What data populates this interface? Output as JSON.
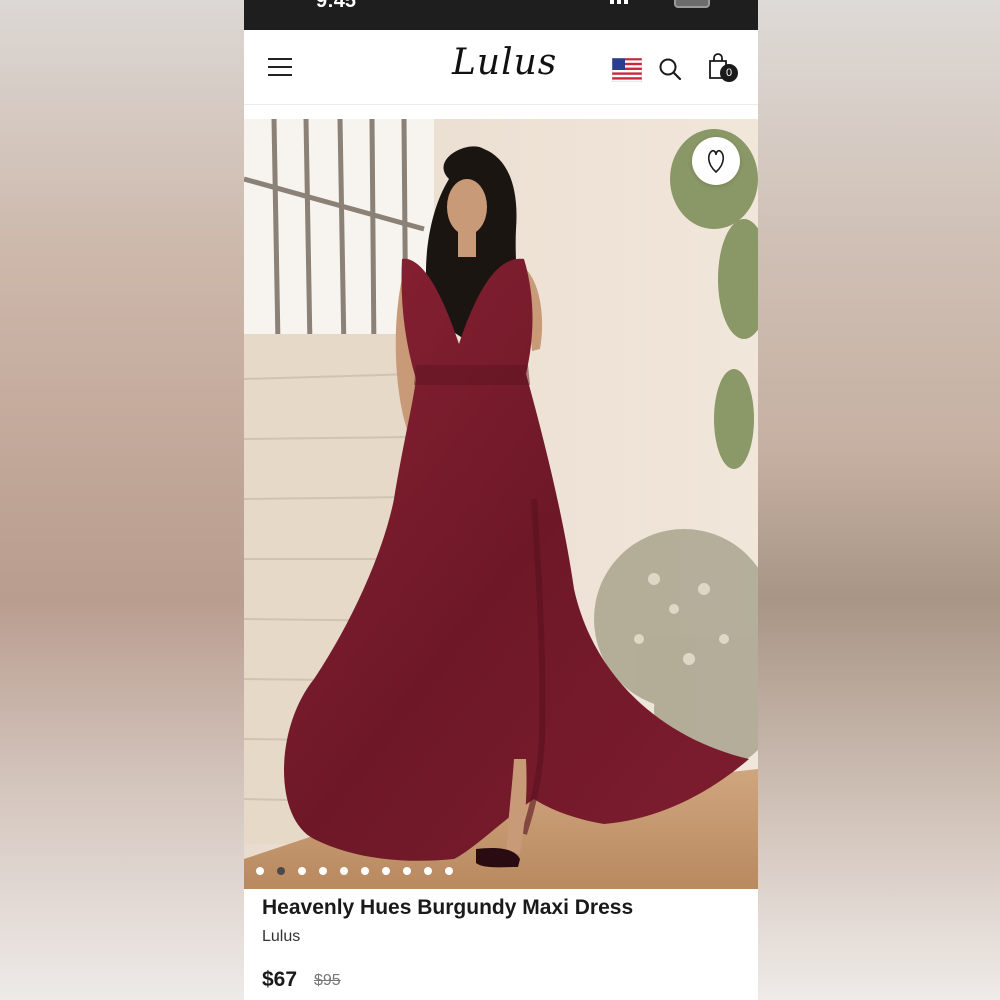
{
  "status_bar": {
    "time": "9:45"
  },
  "header": {
    "logo_text": "Lulus",
    "cart_count": "0",
    "icons": [
      "menu-icon",
      "us-flag-icon",
      "search-icon",
      "shopping-bag-icon"
    ]
  },
  "product": {
    "title": "Heavenly Hues Burgundy Maxi Dress",
    "brand": "Lulus",
    "price": "$67",
    "original_price": "$95",
    "image_count": 10,
    "active_image_index": 1
  },
  "colors": {
    "dress": "#7a1c2c",
    "status_bar": "#1e1e1e",
    "text": "#1a1a1a"
  }
}
